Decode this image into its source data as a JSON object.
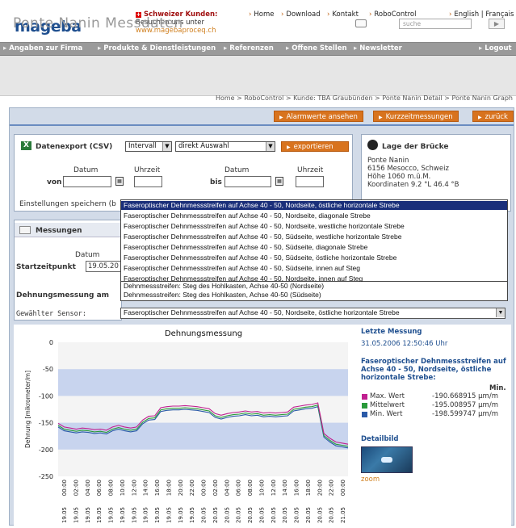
{
  "header": {
    "logo": "mageba",
    "swiss_title": "Schweizer Kunden:",
    "swiss_line2": "Besuchen uns unter",
    "swiss_url": "www.magebaproceq.ch",
    "links": [
      "Home",
      "Download",
      "Kontakt",
      "RoboControl"
    ],
    "lang": "English | Français"
  },
  "nav": {
    "items": [
      "Angaben zur Firma",
      "Produkte & Dienstleistungen",
      "Referenzen",
      "Offene Stellen",
      "Newsletter"
    ],
    "logout": "Logout"
  },
  "page": {
    "title": "Ponte Nanin Messdaten",
    "search_placeholder": "suche",
    "search_go": "▶"
  },
  "breadcrumb": "Home  >  RoboControl  >  Kunde: TBA Graubünden  >  Ponte Nanin Detail  >  Ponte Nanin Graph",
  "actions": {
    "alarm": "Alarmwerte ansehen",
    "kurz": "Kurzzeitmessungen",
    "back": "zurück"
  },
  "export": {
    "title": "Datenexport (CSV)",
    "interval": "Intervall",
    "select": "direkt Auswahl",
    "button": "exportieren",
    "datum": "Datum",
    "uhrzeit": "Uhrzeit",
    "von": "von",
    "bis": "bis",
    "save_settings": "Einstellungen speichern (b"
  },
  "lage": {
    "title": "Lage der Brücke",
    "lines": [
      "Ponte Nanin",
      "6156 Mesocco, Schweiz",
      "Höhe 1060 m.ü.M.",
      "Koordinaten 9.2 °L 46.4 °B"
    ]
  },
  "messungen": {
    "title": "Messungen",
    "datum": "Datum",
    "startzeit_label": "Startzeitpunkt",
    "startzeit_value": "19.05.20",
    "dehnung_label": "Dehnungsmessung am",
    "sensor_label": "Gewählter Sensor:"
  },
  "dropdown": {
    "items": [
      "Faseroptischer Dehnmessstreifen auf Achse 40 - 50, Nordseite, östliche horizontale Strebe",
      "Faseroptischer Dehnmessstreifen auf Achse 40 - 50, Nordseite, diagonale Strebe",
      "Faseroptischer Dehnmessstreifen auf Achse 40 - 50, Nordseite, westliche horizontale Strebe",
      "Faseroptischer Dehnmessstreifen auf Achse 40 - 50, Südseite, westliche horizontale Strebe",
      "Faseroptischer Dehnmessstreifen auf Achse 40 - 50, Südseite, diagonale Strebe",
      "Faseroptischer Dehnmessstreifen auf Achse 40 - 50, Südseite, östliche horizontale Strebe",
      "Faseroptischer Dehnmessstreifen auf Achse 40 - 50, Südseite, innen auf Steg",
      "Faseroptischer Dehnmessstreifen auf Achse 40 - 50, Nordseite, innen auf Steg",
      "Dehnmessstreifen: Steg des Hohlkasten, Achse 40-50 (Nordseite)",
      "Dehnmessstreifen: Steg des Hohlkasten, Achse 40-50 (Südseite)"
    ],
    "selected": "Faseroptischer Dehnmessstreifen auf Achse 40 - 50, Nordseite, östliche horizontale Strebe"
  },
  "right": {
    "letzte_title": "Letzte Messung",
    "letzte_time": "31.05.2006 12:50:46 Uhr",
    "sensor_title": "Faseroptischer Dehnmessstreifen auf Achse 40 - 50, Nordseite, östliche horizontale Strebe:",
    "min_hdr": "Min.",
    "legend": [
      {
        "label": "Max. Wert",
        "value": "-190.668915 µm/m",
        "color": "#c02090"
      },
      {
        "label": "Mittelwert",
        "value": "-195.008957 µm/m",
        "color": "#2a9a3a"
      },
      {
        "label": "Min. Wert",
        "value": "-198.599747 µm/m",
        "color": "#2a5aa8"
      }
    ],
    "detail_title": "Detailbild",
    "zoom": "zoom"
  },
  "chart_data": {
    "type": "line",
    "title": "Dehnungsmessung",
    "ylabel": "Dehnung [mikrometer/m]",
    "xlabel": "",
    "ylim": [
      -250,
      0
    ],
    "yticks": [
      0,
      -50,
      -100,
      -150,
      -200,
      -250
    ],
    "xticks": [
      "19.05 00:00",
      "19.05 02:00",
      "19.05 04:00",
      "19.05 06:00",
      "19.05 08:00",
      "19.05 10:00",
      "19.05 12:00",
      "19.05 14:00",
      "19.05 16:00",
      "19.05 18:00",
      "19.05 20:00",
      "19.05 22:00",
      "20.05 00:00",
      "20.05 02:00",
      "20.05 04:00",
      "20.05 06:00",
      "20.05 08:00",
      "20.05 10:00",
      "20.05 12:00",
      "20.05 14:00",
      "20.05 16:00",
      "20.05 18:00",
      "20.05 20:00",
      "20.05 22:00",
      "21.05 00:00"
    ],
    "bands": [
      [
        -50,
        -100
      ],
      [
        -150,
        -200
      ]
    ],
    "x": [
      0,
      1,
      2,
      3,
      4,
      5,
      6,
      7,
      8,
      9,
      10,
      11,
      12,
      13,
      14,
      15,
      16,
      17,
      18,
      19,
      20,
      21,
      22,
      23,
      24,
      25,
      26,
      27,
      28,
      29,
      30,
      31,
      32,
      33,
      34,
      35,
      36,
      37,
      38,
      39,
      40,
      41,
      42,
      43,
      44,
      45,
      46,
      47,
      48
    ],
    "series": [
      {
        "name": "Max. Wert",
        "color": "#c02090",
        "values": [
          -151,
          -158,
          -160,
          -162,
          -160,
          -161,
          -163,
          -162,
          -164,
          -158,
          -155,
          -158,
          -160,
          -158,
          -145,
          -138,
          -137,
          -122,
          -120,
          -119,
          -119,
          -118,
          -119,
          -120,
          -122,
          -124,
          -133,
          -136,
          -133,
          -131,
          -130,
          -128,
          -130,
          -129,
          -132,
          -131,
          -132,
          -131,
          -130,
          -121,
          -119,
          -117,
          -116,
          -113,
          -170,
          -179,
          -186,
          -188,
          -190
        ]
      },
      {
        "name": "Mittelwert",
        "color": "#2a9a3a",
        "values": [
          -155,
          -162,
          -164,
          -166,
          -164,
          -165,
          -167,
          -166,
          -168,
          -162,
          -159,
          -162,
          -164,
          -162,
          -149,
          -142,
          -141,
          -126,
          -124,
          -123,
          -123,
          -122,
          -123,
          -124,
          -126,
          -128,
          -137,
          -140,
          -137,
          -135,
          -134,
          -132,
          -134,
          -133,
          -136,
          -135,
          -136,
          -135,
          -134,
          -125,
          -123,
          -121,
          -120,
          -117,
          -174,
          -183,
          -190,
          -192,
          -194
        ]
      },
      {
        "name": "Min. Wert",
        "color": "#2a5aa8",
        "values": [
          -158,
          -165,
          -167,
          -169,
          -167,
          -168,
          -170,
          -169,
          -171,
          -165,
          -162,
          -165,
          -167,
          -165,
          -152,
          -145,
          -144,
          -129,
          -127,
          -126,
          -126,
          -125,
          -126,
          -127,
          -129,
          -131,
          -140,
          -143,
          -140,
          -138,
          -137,
          -135,
          -137,
          -136,
          -139,
          -138,
          -139,
          -138,
          -137,
          -128,
          -126,
          -124,
          -123,
          -120,
          -177,
          -186,
          -193,
          -195,
          -197
        ]
      }
    ]
  }
}
